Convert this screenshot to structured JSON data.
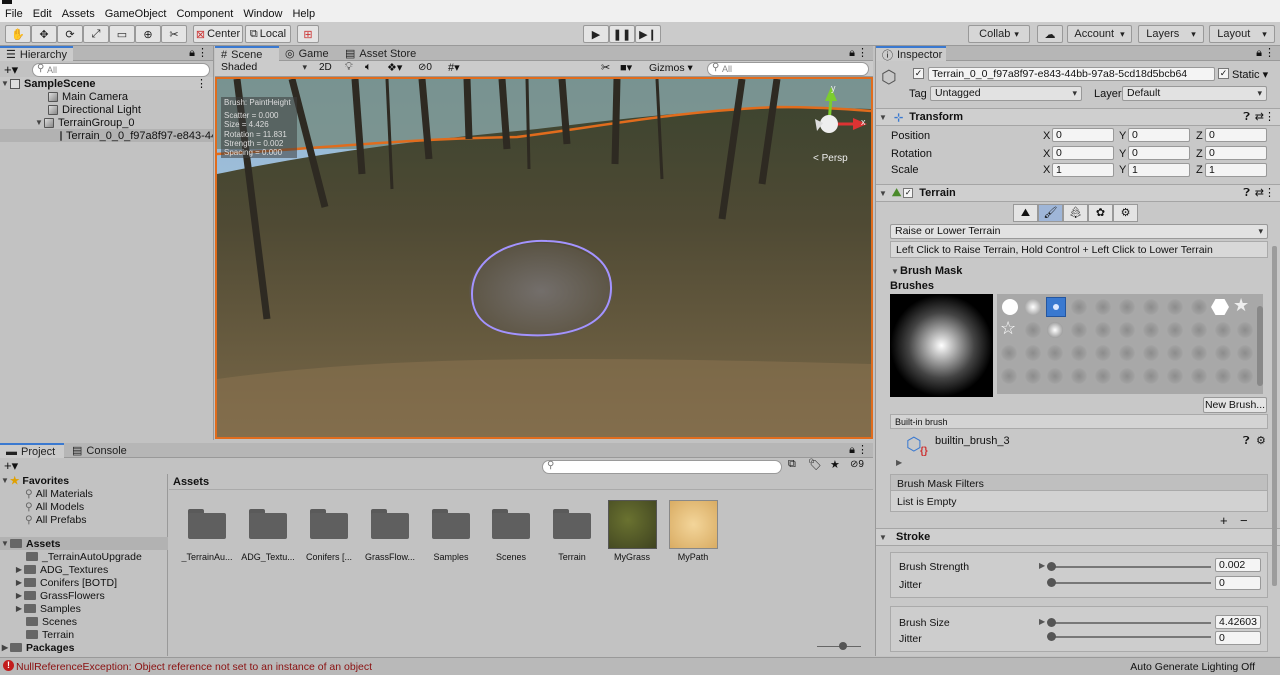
{
  "menu": [
    "File",
    "Edit",
    "Assets",
    "GameObject",
    "Component",
    "Window",
    "Help"
  ],
  "toolbar": {
    "center_label": "Center",
    "local_label": "Local",
    "collab_label": "Collab",
    "account_label": "Account",
    "layers_label": "Layers",
    "layout_label": "Layout"
  },
  "hierarchy": {
    "tab": "Hierarchy",
    "search_placeholder": "All",
    "items": [
      {
        "label": "SampleScene"
      },
      {
        "label": "Main Camera"
      },
      {
        "label": "Directional Light"
      },
      {
        "label": "TerrainGroup_0"
      },
      {
        "label": "Terrain_0_0_f97a8f97-e843-44"
      }
    ]
  },
  "scene_tabs": {
    "scene": "Scene",
    "game": "Game",
    "asset_store": "Asset Store"
  },
  "scene_toolbar": {
    "shading": "Shaded",
    "mode_2d": "2D",
    "hidden_count": "0",
    "gizmos": "Gizmos",
    "search_placeholder": "All"
  },
  "scene_overlay": {
    "lines": [
      "Brush: PaintHeight",
      "Scatter = 0.000",
      "Size = 4.426",
      "Rotation = 11.831",
      "Strength = 0.002",
      "Spacing = 0.000"
    ],
    "persp": "< Persp",
    "axis_x": "x",
    "axis_y": "y"
  },
  "inspector": {
    "tab": "Inspector",
    "object_name": "Terrain_0_0_f97a8f97-e843-44bb-97a8-5cd18d5bcb64",
    "static_label": "Static",
    "tag_label": "Tag",
    "tag_value": "Untagged",
    "layer_label": "Layer",
    "layer_value": "Default",
    "transform": {
      "title": "Transform",
      "position_label": "Position",
      "rotation_label": "Rotation",
      "scale_label": "Scale",
      "axis_labels": [
        "X",
        "Y",
        "Z"
      ],
      "position": [
        "0",
        "0",
        "0"
      ],
      "rotation": [
        "0",
        "0",
        "0"
      ],
      "scale": [
        "1",
        "1",
        "1"
      ]
    },
    "terrain": {
      "title": "Terrain",
      "tool_dropdown": "Raise or Lower Terrain",
      "help_text": "Left Click to Raise Terrain, Hold Control + Left Click to Lower Terrain",
      "brush_mask": "Brush Mask",
      "brushes": "Brushes",
      "new_brush": "New Brush...",
      "builtin_brush_label": "Built-in brush",
      "brush_name": "builtin_brush_3",
      "mask_filters": "Brush Mask Filters",
      "list_empty": "List is Empty",
      "add": "+",
      "remove": "−"
    },
    "stroke": {
      "title": "Stroke",
      "strength_label": "Brush Strength",
      "strength_value": "0.002",
      "strength_jitter_label": "Jitter",
      "strength_jitter_value": "0",
      "size_label": "Brush Size",
      "size_value": "4.42603",
      "size_jitter_label": "Jitter",
      "size_jitter_value": "0",
      "strength_fraction": 0.0,
      "size_fraction": 0.0
    }
  },
  "project": {
    "tabs": {
      "project": "Project",
      "console": "Console"
    },
    "hidden_count": "9",
    "favorites_label": "Favorites",
    "favorites": [
      "All Materials",
      "All Models",
      "All Prefabs"
    ],
    "assets_label": "Assets",
    "tree": [
      "_TerrainAutoUpgrade",
      "ADG_Textures",
      "Conifers [BOTD]",
      "GrassFlowers",
      "Samples",
      "Scenes",
      "Terrain"
    ],
    "packages_label": "Packages",
    "grid_title": "Assets",
    "grid_items": [
      "_TerrainAu...",
      "ADG_Textu...",
      "Conifers [...",
      "GrassFlow...",
      "Samples",
      "Scenes",
      "Terrain",
      "MyGrass",
      "MyPath"
    ]
  },
  "status": {
    "error": "NullReferenceException: Object reference not set to an instance of an object",
    "right": "Auto Generate Lighting Off"
  },
  "colors": {
    "accent_orange": "#e06c1d",
    "selection_blue": "#3a79d0",
    "error_red": "#c31d1d"
  }
}
